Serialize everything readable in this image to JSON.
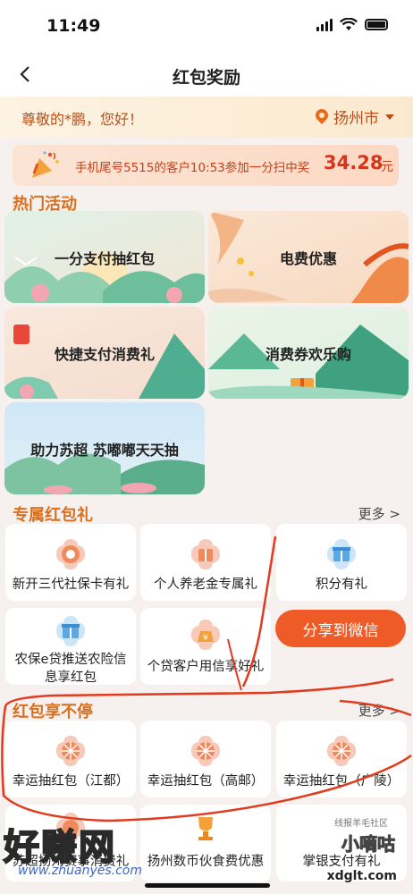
{
  "status": {
    "time": "11:49"
  },
  "nav": {
    "title": "红包奖励",
    "back_icon": "chevron-left-icon"
  },
  "greeting": {
    "text": "尊敬的*鹏，您好！",
    "city": "扬州市"
  },
  "winner": {
    "text": "手机尾号5515的客户10:53参加一分扫中奖",
    "amount": "34.28",
    "unit": "元"
  },
  "hot": {
    "title": "热门活动",
    "cards": [
      {
        "label": "一分支付抽红包"
      },
      {
        "label": "电费优惠"
      },
      {
        "label": "快捷支付消费礼"
      },
      {
        "label": "消费券欢乐购"
      },
      {
        "label": "助力苏超 苏嘟嘟天天抽"
      }
    ]
  },
  "exclusive": {
    "title": "专属红包礼",
    "more": "更多 >",
    "items": [
      {
        "label": "新开三代社保卡有礼",
        "icon": "flower-badge-icon"
      },
      {
        "label": "个人养老金专属礼",
        "icon": "gift-badge-icon"
      },
      {
        "label": "积分有礼",
        "icon": "gift-box-icon"
      },
      {
        "label": "农保e贷推送农险信息享红包",
        "icon": "gift-box-icon"
      },
      {
        "label": "个贷客户用信享好礼",
        "icon": "money-bag-icon"
      }
    ],
    "share_button": "分享到微信"
  },
  "nonstop": {
    "title": "红包享不停",
    "more": "更多 >",
    "items": [
      {
        "label": "幸运抽红包（江都）"
      },
      {
        "label": "幸运抽红包（高邮）"
      },
      {
        "label": "幸运抽红包（广陵）"
      },
      {
        "label": "苏超扬州赛事消费礼"
      },
      {
        "label": "扬州数币伙食费优惠"
      },
      {
        "label": "掌银支付有礼"
      }
    ]
  },
  "watermarks": {
    "left": "好赚网",
    "url": "www.zhuanyes.com",
    "right": "小嘀咕",
    "right_small": "线报羊毛社区",
    "domain": "xdglt.com"
  },
  "colors": {
    "accent": "#ef5b27",
    "section": "#d9701f",
    "annotation": "#e23a1e"
  }
}
